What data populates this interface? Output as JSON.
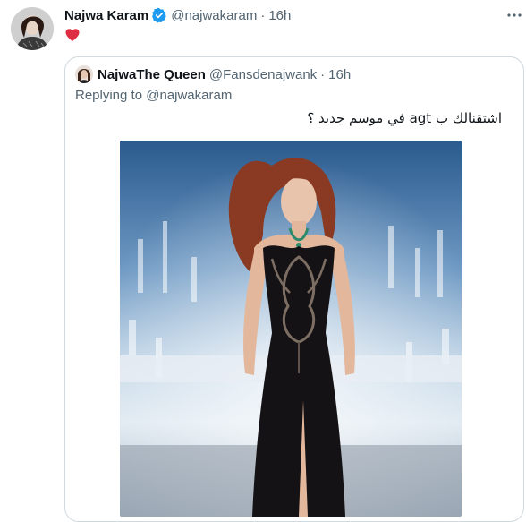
{
  "tweet": {
    "author_name": "Najwa Karam",
    "author_handle": "@najwakaram",
    "separator": "·",
    "time": "16h",
    "verified": true,
    "content_emoji": "heart",
    "heart_color": "#f91880",
    "icons": {
      "verified": "verified-badge-icon",
      "more": "more-options-icon",
      "heart": "red-heart-emoji"
    }
  },
  "quote": {
    "author_name": "NajwaThe Queen",
    "author_handle": "@Fansdenajwank",
    "separator": "·",
    "time": "16h",
    "replying_prefix": "Replying to",
    "replying_mention": "@najwakaram",
    "text": "اشتقنالك ب agt في موسم جديد ؟",
    "media": "photo-of-singer-in-black-gown-on-stage"
  },
  "colors": {
    "text_primary": "#0f1419",
    "text_secondary": "#536471",
    "verified_blue": "#1d9bf0",
    "border": "#cfd9de"
  }
}
